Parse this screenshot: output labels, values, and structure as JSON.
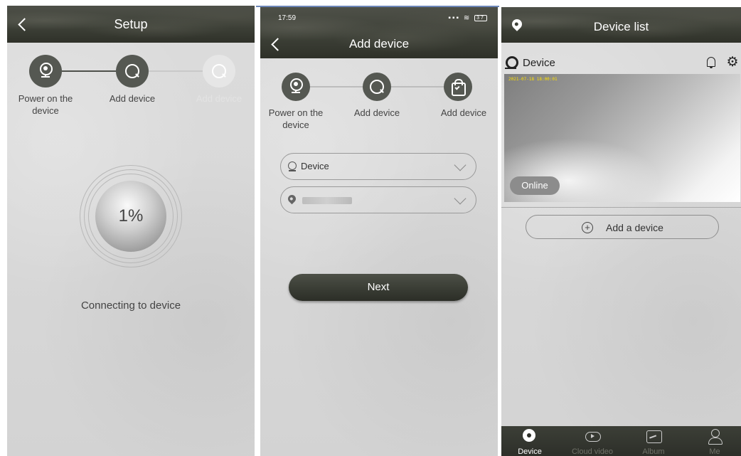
{
  "setup_screen": {
    "title": "Setup",
    "steps": [
      {
        "label": "Power on the device",
        "state": "done"
      },
      {
        "label": "Add device",
        "state": "active"
      },
      {
        "label": "Add device",
        "state": "pending"
      }
    ],
    "progress_text": "1%",
    "progress_value": 0.01,
    "status": "Connecting to device"
  },
  "add_device_screen": {
    "status_bar": {
      "time": "17:59",
      "battery": "37"
    },
    "title": "Add device",
    "steps": [
      {
        "label": "Power on the device",
        "icon": "camera-icon"
      },
      {
        "label": "Add device",
        "icon": "search-icon"
      },
      {
        "label": "Add device",
        "icon": "bag-check-icon"
      }
    ],
    "device_select": {
      "value": "Device",
      "icon": "camera-icon"
    },
    "location_select": {
      "icon": "location-pin-icon"
    },
    "next_button": "Next"
  },
  "device_list_screen": {
    "title": "Device list",
    "device": {
      "name": "Device",
      "timestamp": "2021-07-18 18:00:01",
      "status": "Online"
    },
    "add_button": "Add a device",
    "tabs": [
      {
        "label": "Device",
        "icon": "camera-icon",
        "active": true
      },
      {
        "label": "Cloud video",
        "icon": "cloud-video-icon",
        "active": false
      },
      {
        "label": "Album",
        "icon": "album-icon",
        "active": false
      },
      {
        "label": "Me",
        "icon": "person-icon",
        "active": false
      }
    ]
  },
  "colors": {
    "header_dark": "#3e4138",
    "step_active": "#555852",
    "timestamp_yellow": "#ffe100",
    "panel_bg": "#d8d8d8"
  }
}
